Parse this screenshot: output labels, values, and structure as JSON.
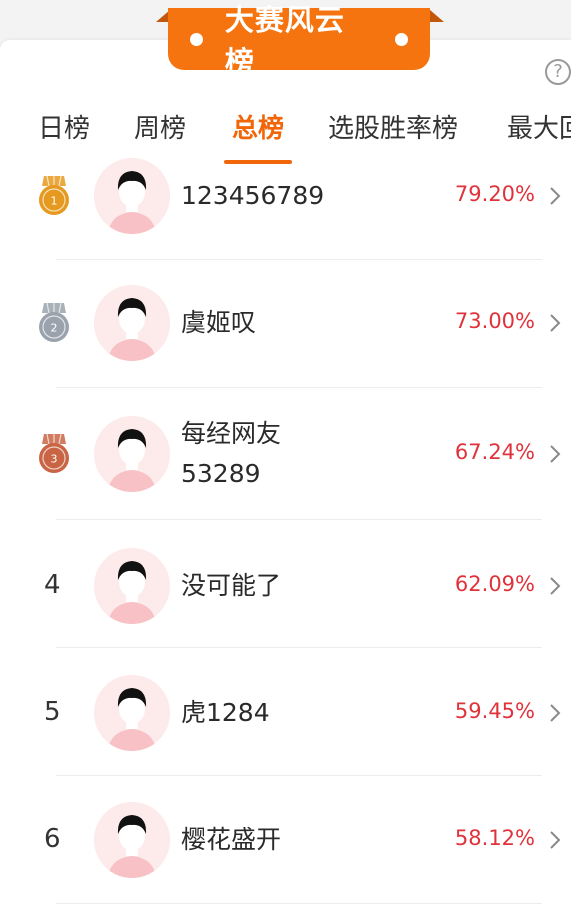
{
  "banner": {
    "title": "大赛风云榜"
  },
  "help": {
    "icon": "question-mark-circle-icon",
    "glyph": "?"
  },
  "tabs": [
    {
      "label": "日榜",
      "active": false
    },
    {
      "label": "周榜",
      "active": false
    },
    {
      "label": "总榜",
      "active": true
    },
    {
      "label": "选股胜率榜",
      "active": false
    },
    {
      "label": "最大回",
      "active": false
    }
  ],
  "colors": {
    "accent": "#f57410",
    "percent": "#e0323a",
    "gold": "#e59a1f",
    "silver": "#9aa3ad",
    "bronze": "#c96545"
  },
  "rows": [
    {
      "rank": "1",
      "medal": "gold",
      "name_lines": [
        "123456789"
      ],
      "percent": "79.20%"
    },
    {
      "rank": "2",
      "medal": "silver",
      "name_lines": [
        "虞姬叹"
      ],
      "percent": "73.00%"
    },
    {
      "rank": "3",
      "medal": "bronze",
      "name_lines": [
        "每经网友",
        "53289"
      ],
      "percent": "67.24%"
    },
    {
      "rank": "4",
      "medal": null,
      "name_lines": [
        "没可能了"
      ],
      "percent": "62.09%"
    },
    {
      "rank": "5",
      "medal": null,
      "name_lines": [
        "虎1284"
      ],
      "percent": "59.45%"
    },
    {
      "rank": "6",
      "medal": null,
      "name_lines": [
        "樱花盛开"
      ],
      "percent": "58.12%"
    }
  ]
}
